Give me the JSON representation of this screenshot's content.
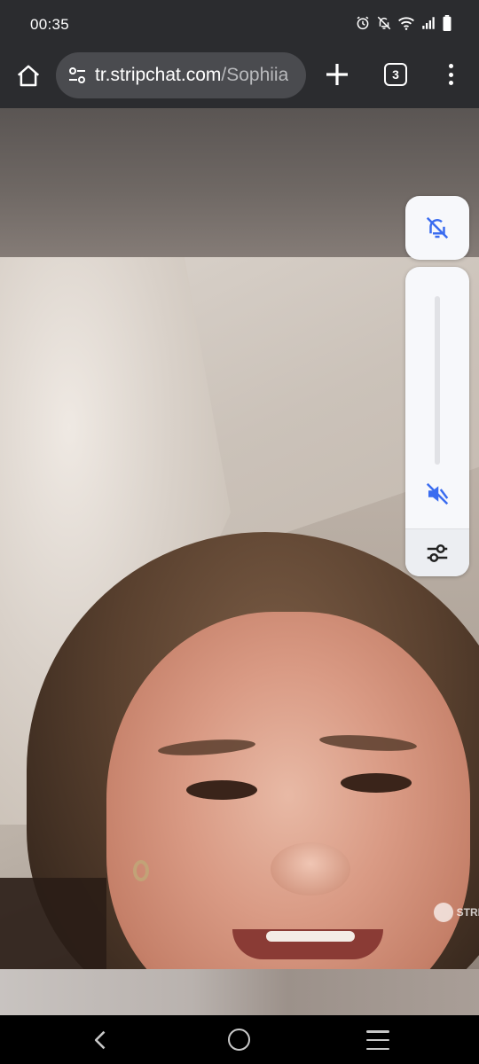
{
  "status_bar": {
    "time": "00:35",
    "icons": [
      "alarm-icon",
      "bell-off-icon",
      "wifi-icon",
      "signal-icon",
      "battery-icon"
    ]
  },
  "toolbar": {
    "url_domain": "tr.stripchat.com",
    "url_path": "/Sophiia",
    "tab_count": "3",
    "icons": [
      "home-icon",
      "site-settings-icon",
      "plus-icon",
      "tabs-icon",
      "more-vert-icon"
    ]
  },
  "player": {
    "watermark": "STRI",
    "controls": [
      "bell-off-icon",
      "volume-slider",
      "volume-muted-icon",
      "sliders-icon"
    ],
    "volume_level": 0,
    "accent_color": "#3a6cf0"
  },
  "nav_bar": {
    "icons": [
      "back-icon",
      "home-circle-icon",
      "recents-icon"
    ]
  }
}
